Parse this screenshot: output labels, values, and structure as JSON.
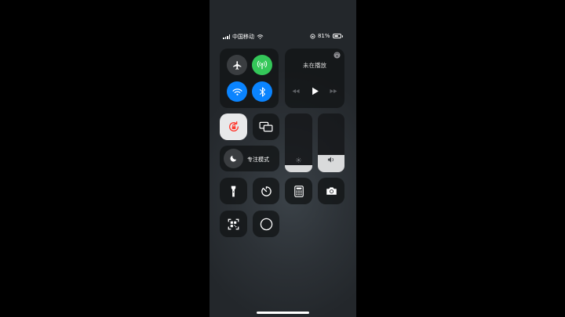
{
  "status_bar": {
    "carrier": "中国移动",
    "battery_percent": "81%",
    "battery_level": 0.81
  },
  "connectivity": {
    "airplane_mode": {
      "icon": "airplane-icon",
      "active": false
    },
    "cellular_data": {
      "icon": "antenna-icon",
      "active": true,
      "color": "#34c759"
    },
    "wifi": {
      "icon": "wifi-icon",
      "active": true,
      "color": "#0a84ff"
    },
    "bluetooth": {
      "icon": "bluetooth-icon",
      "active": true,
      "color": "#0a84ff"
    }
  },
  "now_playing": {
    "title": "未在播放",
    "airplay_icon": "airplay-icon",
    "controls": [
      "rewind-icon",
      "play-icon",
      "fast-forward-icon"
    ]
  },
  "orientation_lock": {
    "icon": "orientation-lock-icon",
    "active": true,
    "accent": "#ff3b30"
  },
  "screen_mirroring": {
    "icon": "screen-mirroring-icon"
  },
  "focus": {
    "label": "专注模式",
    "icon": "moon-icon"
  },
  "sliders": {
    "brightness": {
      "icon": "sun-icon",
      "level": 0.12
    },
    "volume": {
      "icon": "speaker-icon",
      "level": 0.3
    }
  },
  "shortcuts": [
    "flashlight-icon",
    "timer-icon",
    "calculator-icon",
    "camera-icon",
    "qr-code-scanner-icon",
    "screen-recording-icon"
  ]
}
